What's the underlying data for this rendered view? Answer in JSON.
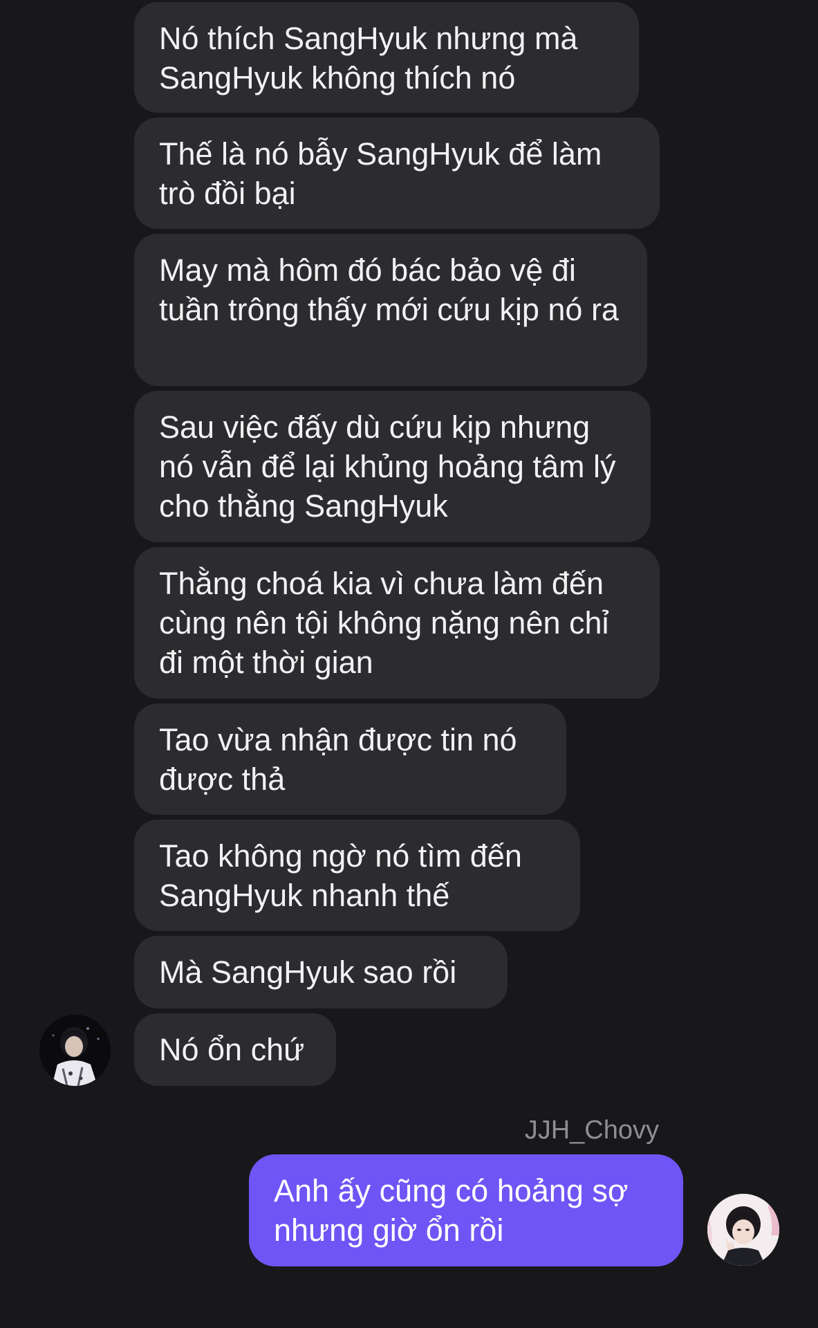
{
  "conversation": {
    "incoming": [
      {
        "text": "Nó thích SangHyuk nhưng mà SangHyuk không thích nó"
      },
      {
        "text": "Thế là nó bẫy SangHyuk để làm trò đồi bại"
      },
      {
        "text": "May mà hôm đó bác bảo vệ đi tuần trông thấy mới cứu kịp nó ra"
      },
      {
        "text": "Sau việc đấy dù cứu kịp nhưng nó vẫn để lại khủng hoảng tâm lý cho thằng SangHyuk"
      },
      {
        "text": "Thằng choá kia vì chưa làm đến cùng nên tội không nặng nên chỉ đi một thời gian"
      },
      {
        "text": "Tao vừa nhận được tin nó được thả"
      },
      {
        "text": "Tao không ngờ nó tìm đến SangHyuk nhanh thế"
      },
      {
        "text": "Mà SangHyuk sao rồi"
      },
      {
        "text": "Nó ổn chứ"
      }
    ],
    "outgoing": {
      "sender_name": "JJH_Chovy",
      "text": "Anh ấy cũng có hoảng sợ nhưng giờ ổn rồi"
    }
  },
  "colors": {
    "background": "#18181a",
    "incoming_bubble": "#2c2c2e",
    "outgoing_bubble": "#6f55f5",
    "sender_name": "#8e8e93"
  }
}
